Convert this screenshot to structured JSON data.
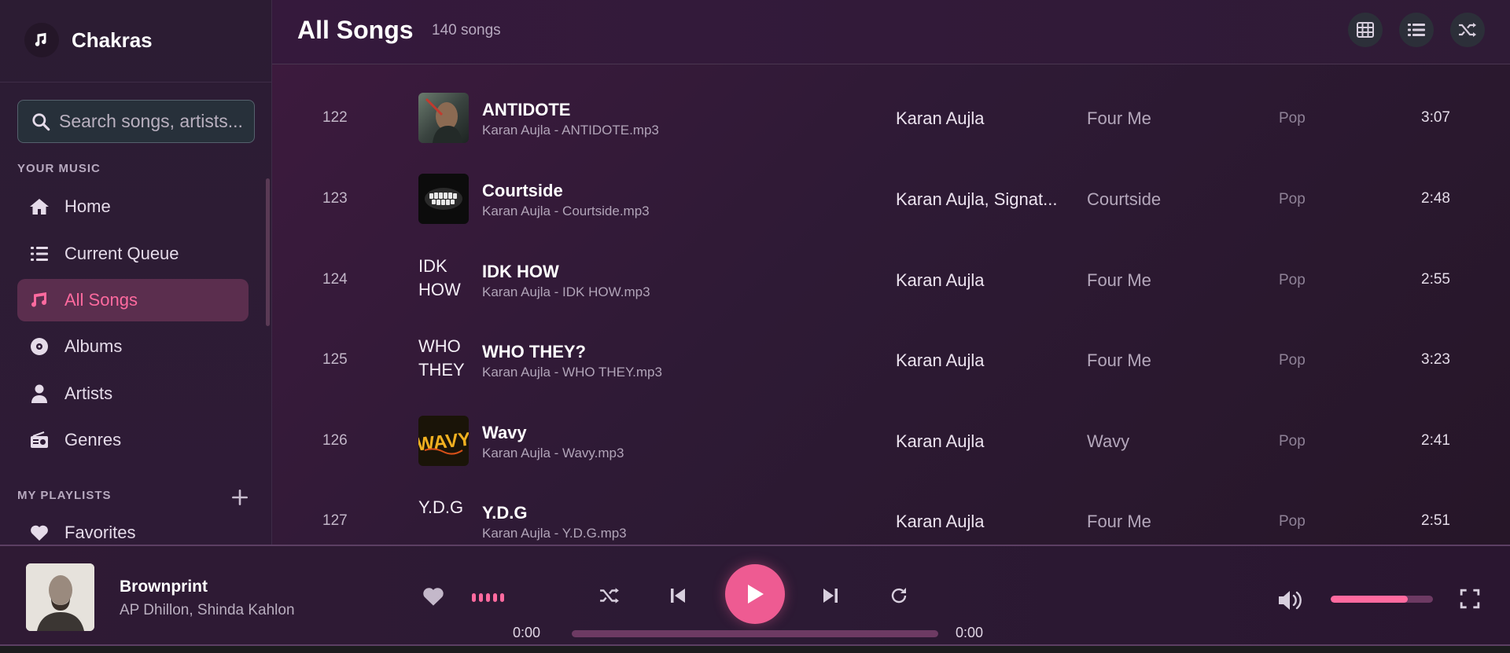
{
  "app": {
    "name": "Chakras"
  },
  "search": {
    "placeholder": "Search songs, artists..."
  },
  "sidebar": {
    "your_music_title": "YOUR MUSIC",
    "items": [
      {
        "label": "Home",
        "icon": "home-icon",
        "active": false
      },
      {
        "label": "Current Queue",
        "icon": "list-icon",
        "active": false
      },
      {
        "label": "All Songs",
        "icon": "music-note-icon",
        "active": true
      },
      {
        "label": "Albums",
        "icon": "disc-icon",
        "active": false
      },
      {
        "label": "Artists",
        "icon": "user-icon",
        "active": false
      },
      {
        "label": "Genres",
        "icon": "radio-icon",
        "active": false
      }
    ],
    "playlists_title": "MY PLAYLISTS",
    "playlists": [
      {
        "label": "Favorites",
        "icon": "heart-icon"
      }
    ]
  },
  "header": {
    "title": "All Songs",
    "count": "140 songs",
    "buttons": [
      "grid-view-icon",
      "list-view-icon",
      "shuffle-icon"
    ]
  },
  "songs": [
    {
      "num": "122",
      "title": "ANTIDOTE",
      "file": "Karan Aujla - ANTIDOTE.mp3",
      "artist": "Karan Aujla",
      "album": "Four Me",
      "genre": "Pop",
      "duration": "3:07",
      "art": "image"
    },
    {
      "num": "123",
      "title": "Courtside",
      "file": "Karan Aujla - Courtside.mp3",
      "artist": "Karan Aujla, Signat...",
      "album": "Courtside",
      "genre": "Pop",
      "duration": "2:48",
      "art": "image"
    },
    {
      "num": "124",
      "title": "IDK HOW",
      "file": "Karan Aujla - IDK HOW.mp3",
      "artist": "Karan Aujla",
      "album": "Four Me",
      "genre": "Pop",
      "duration": "2:55",
      "art": "broken",
      "alt": "IDK HOW"
    },
    {
      "num": "125",
      "title": "WHO THEY?",
      "file": "Karan Aujla - WHO THEY.mp3",
      "artist": "Karan Aujla",
      "album": "Four Me",
      "genre": "Pop",
      "duration": "3:23",
      "art": "broken",
      "alt": "WHO THEY"
    },
    {
      "num": "126",
      "title": "Wavy",
      "file": "Karan Aujla - Wavy.mp3",
      "artist": "Karan Aujla",
      "album": "Wavy",
      "genre": "Pop",
      "duration": "2:41",
      "art": "image"
    },
    {
      "num": "127",
      "title": "Y.D.G",
      "file": "Karan Aujla - Y.D.G.mp3",
      "artist": "Karan Aujla",
      "album": "Four Me",
      "genre": "Pop",
      "duration": "2:51",
      "art": "broken",
      "alt": "Y.D.G"
    }
  ],
  "player": {
    "title": "Brownprint",
    "artist": "AP Dhillon, Shinda Kahlon",
    "current_time": "0:00",
    "total_time": "0:00",
    "progress": 0,
    "volume": 0.75
  },
  "colors": {
    "accent": "#ee5b92",
    "accent_light": "#ff6a9f"
  }
}
